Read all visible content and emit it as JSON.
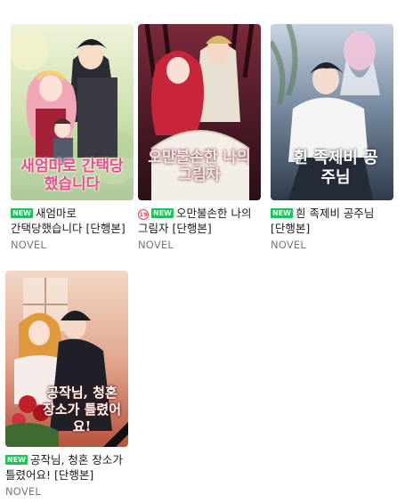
{
  "books": [
    {
      "badge": "NEW",
      "title": "새엄마로 간택당했습니다 [단행본]",
      "category": "NOVEL",
      "cover_title": "새엄마로 간택당했습니다",
      "cover_colors": {
        "bg": "#dfe9c8",
        "accent": "#e94e86"
      }
    },
    {
      "age_badge": "19",
      "badge": "NEW",
      "title": "오만불손한 나의 그림자 [단행본]",
      "category": "NOVEL",
      "cover_title": "오만불손한 나의 그림자",
      "cover_colors": {
        "bg": "#5a1f2a",
        "accent": "#f1c9c9"
      }
    },
    {
      "badge": "NEW",
      "title": "흰 족제비 공주님 [단행본]",
      "category": "NOVEL",
      "cover_title": "흰 족제비 공주님",
      "cover_colors": {
        "bg": "#3a4a5c",
        "accent": "#f7d0e6"
      }
    },
    {
      "badge": "NEW",
      "title": "공작님, 청혼 장소가 틀렸어요! [단행본]",
      "category": "NOVEL",
      "cover_title": "공작님, 청혼 장소가 틀렸어요!",
      "cover_colors": {
        "bg": "#e9b7a0",
        "accent": "#c21f2c"
      }
    }
  ]
}
